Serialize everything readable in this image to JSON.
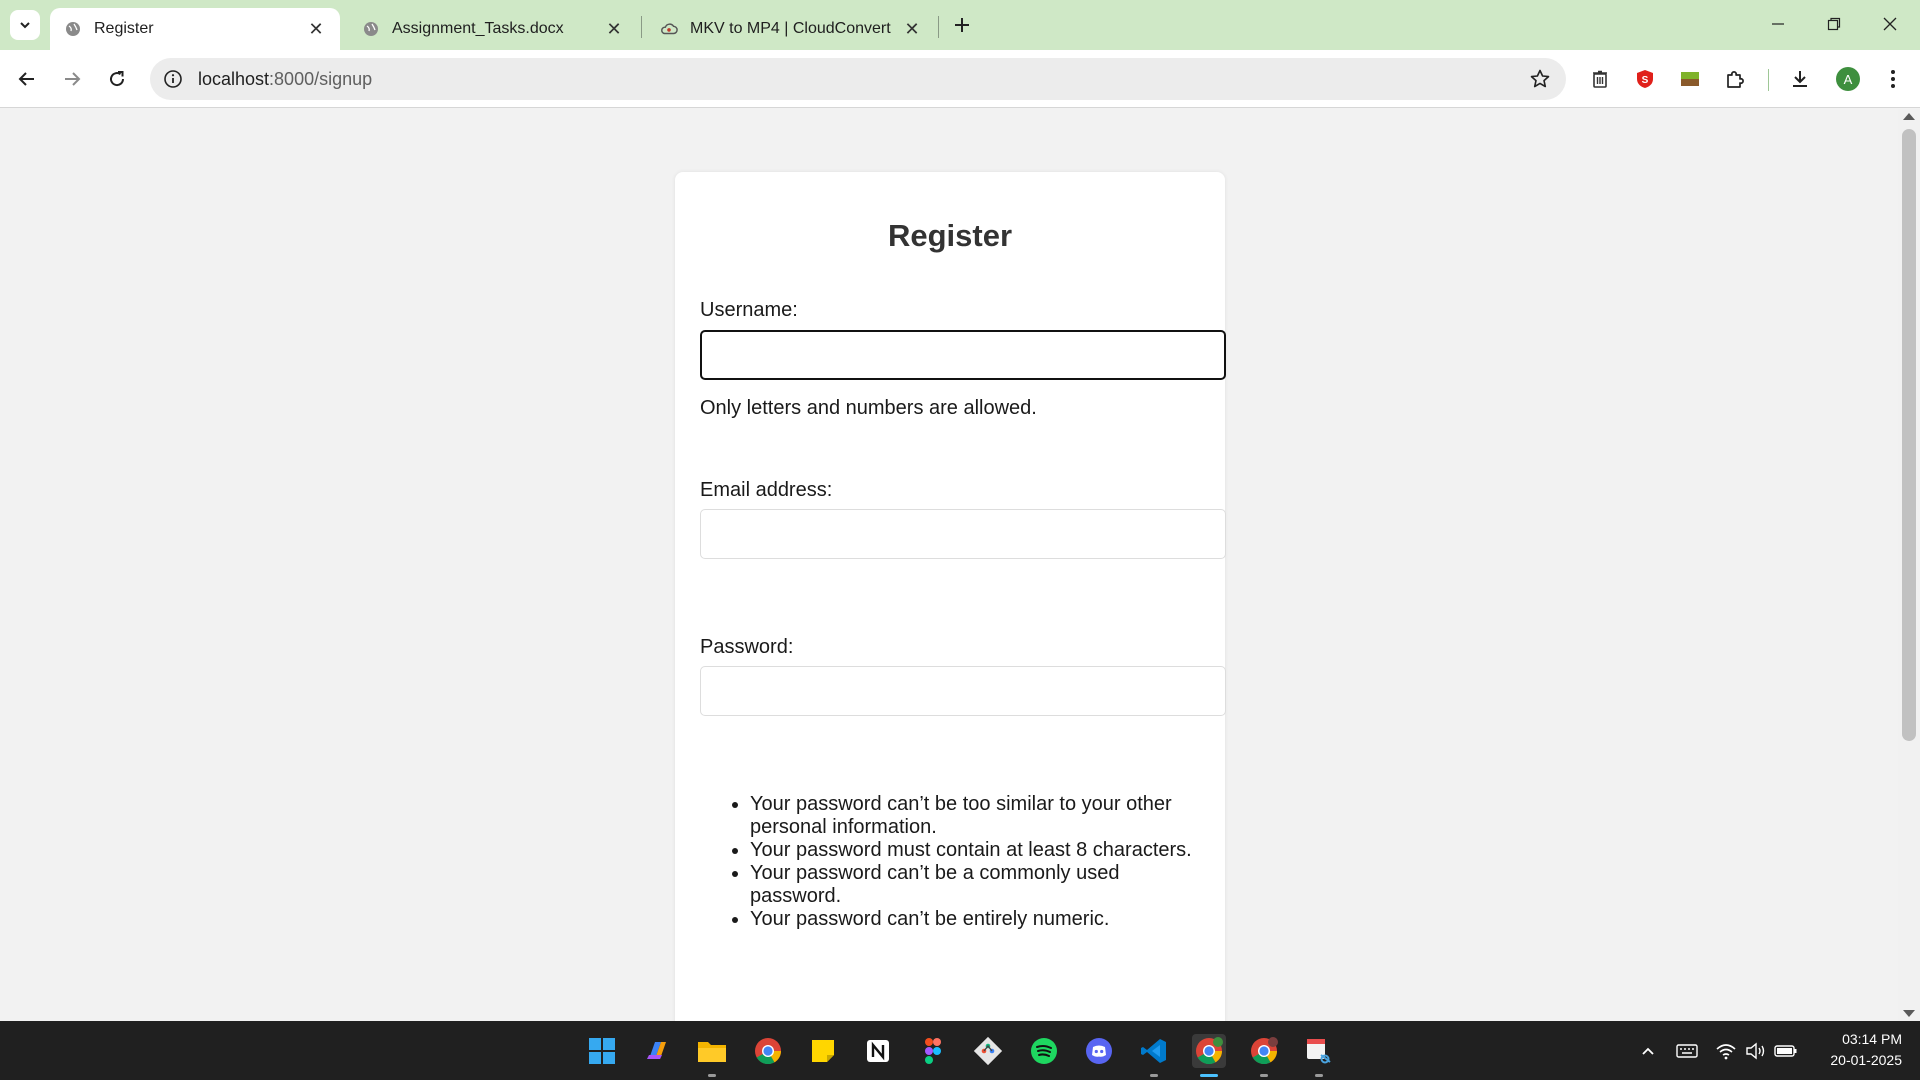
{
  "browser": {
    "tabs": [
      {
        "title": "Register",
        "active": true
      },
      {
        "title": "Assignment_Tasks.docx",
        "active": false
      },
      {
        "title": "MKV to MP4 | CloudConvert",
        "active": false
      }
    ],
    "url_host": "localhost",
    "url_path": ":8000/signup",
    "profile_initial": "A"
  },
  "form": {
    "heading": "Register",
    "username_label": "Username:",
    "username_value": "",
    "username_help": "Only letters and numbers are allowed.",
    "email_label": "Email address:",
    "email_value": "",
    "password_label": "Password:",
    "password_value": "",
    "password_rules": [
      "Your password can’t be too similar to your other personal information.",
      "Your password must contain at least 8 characters.",
      "Your password can’t be a commonly used password.",
      "Your password can’t be entirely numeric."
    ]
  },
  "taskbar": {
    "apps": [
      "start",
      "copilot",
      "file-explorer",
      "chrome",
      "sticky-notes",
      "notion",
      "figma",
      "git",
      "spotify",
      "discord",
      "vscode",
      "chrome-profile",
      "chrome",
      "snipping-tool"
    ],
    "time": "03:14 PM",
    "date": "20-01-2025"
  },
  "colors": {
    "tabstrip": "#cfe8c6",
    "page_bg": "#f2f2f2",
    "card_bg": "#ffffff",
    "taskbar": "#202020",
    "accent": "#4cc2ff"
  }
}
